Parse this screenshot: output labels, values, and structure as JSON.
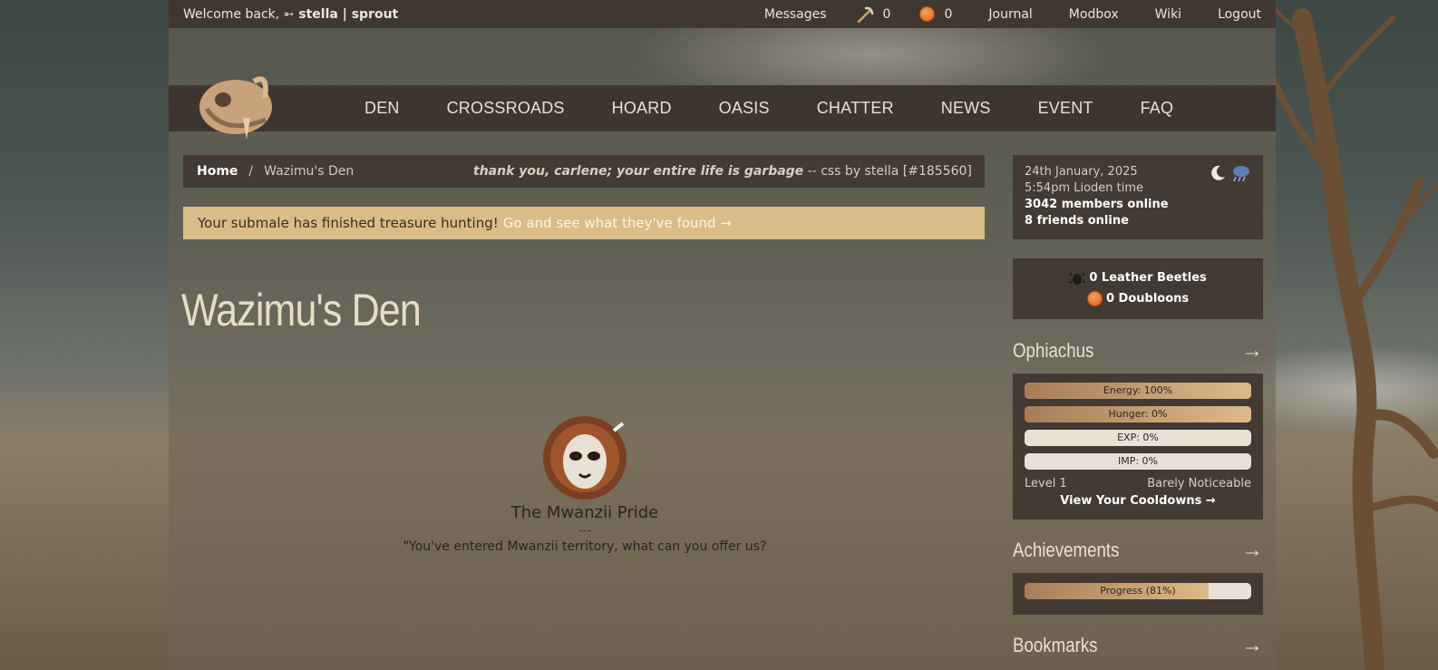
{
  "topbar": {
    "welcome_prefix": "Welcome back,",
    "user": "➵ stella | sprout",
    "messages": "Messages",
    "pick_count": "0",
    "coin_count": "0",
    "journal": "Journal",
    "modbox": "Modbox",
    "wiki": "Wiki",
    "logout": "Logout"
  },
  "nav": [
    "DEN",
    "CROSSROADS",
    "HOARD",
    "OASIS",
    "CHATTER",
    "NEWS",
    "EVENT",
    "FAQ"
  ],
  "breadcrumb": {
    "home": "Home",
    "sep": "/",
    "current": "Wazimu's Den",
    "quote_em": "thank you, carlene; your entire life is garbage",
    "quote_rest": " -- css by stella [#185560]"
  },
  "notice": {
    "text": "Your submale has finished treasure hunting!",
    "link": "Go and see what they've found →"
  },
  "page": {
    "title": "Wazimu's Den",
    "pride_name": "The Mwanzii Pride",
    "divider": "---",
    "pride_quote": "\"You've entered Mwanzii territory, what can you offer us?"
  },
  "sidebar": {
    "date": "24th January, 2025",
    "time": "5:54pm Lioden time",
    "members": "3042 members online",
    "friends": "8 friends online",
    "beetles": "0 Leather Beetles",
    "doubloons": "0 Doubloons",
    "lion_name": "Ophiachus",
    "arrow": "→",
    "stats": [
      {
        "label": "Energy: 100%",
        "pct": 100
      },
      {
        "label": "Hunger: 0%",
        "pct": 100
      },
      {
        "label": "EXP: 0%",
        "pct": 0
      },
      {
        "label": "IMP: 0%",
        "pct": 0
      }
    ],
    "level": "Level 1",
    "level_desc": "Barely Noticeable",
    "cooldowns": "View Your Cooldowns →",
    "achievements_title": "Achievements",
    "progress_label": "Progress (81%)",
    "progress_pct": 81,
    "bookmarks_title": "Bookmarks"
  },
  "colors": {
    "panel": "#433a33",
    "notice": "#d9bc87",
    "bar_fill_start": "#a97c58",
    "bar_fill_end": "#dcba87"
  }
}
